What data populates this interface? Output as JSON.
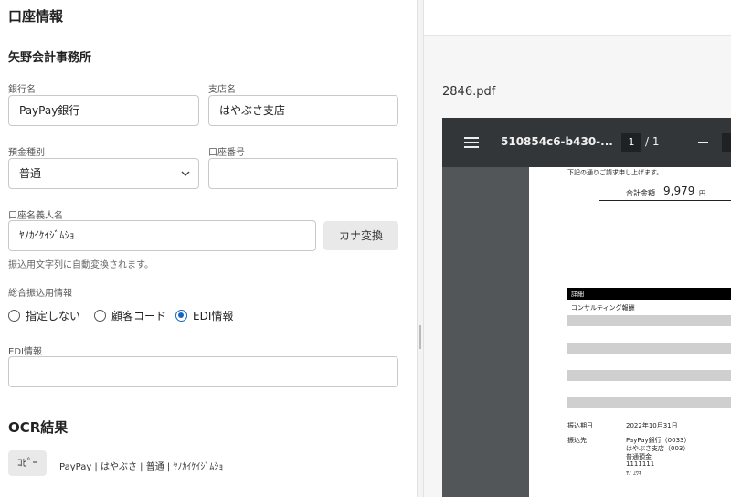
{
  "left": {
    "section_title": "口座情報",
    "company_name": "矢野会計事務所",
    "bank": {
      "label": "銀行名",
      "value": "PayPay銀行"
    },
    "branch": {
      "label": "支店名",
      "value": "はやぶさ支店"
    },
    "account_type": {
      "label": "預金種別",
      "value": "普通",
      "icon": "chevron-down-icon"
    },
    "account_number": {
      "label": "口座番号",
      "value": ""
    },
    "holder": {
      "label": "口座名義人名",
      "value": "ﾔﾉｶｲｹｲｼﾞﾑｼｮ",
      "convert_button": "カナ変換",
      "hint": "振込用文字列に自動変換されます。"
    },
    "transfer_info": {
      "label": "総合振込用情報",
      "options": [
        {
          "label": "指定しない",
          "selected": false
        },
        {
          "label": "顧客コード",
          "selected": false
        },
        {
          "label": "EDI情報",
          "selected": true
        }
      ]
    },
    "edi": {
      "label": "EDI情報",
      "value": ""
    },
    "ocr": {
      "title": "OCR結果",
      "copy_button": "ｺﾋﾟｰ",
      "text": "PayPay | はやぶさ | 普通 | ﾔﾉｶｲｹｲｼﾞﾑｼｮ"
    }
  },
  "preview": {
    "file_name": "2846.pdf",
    "viewer": {
      "doc_title": "510854c6-b430-...",
      "page_current": "1",
      "page_total": "/ 1"
    },
    "page": {
      "intro": "下記の通りご請求申し上げます。",
      "total_label": "合計金額",
      "total_value": "9,979",
      "total_unit": "円",
      "detail_header": "詳細",
      "detail_item": "コンサルティング報酬",
      "due_label": "振込期日",
      "due_value": "2022年10月31日",
      "dest_label": "振込先",
      "dest_lines": [
        "PayPay銀行（0033）",
        "はやぶさ支店（003）",
        "普通預金",
        "1111111",
        "ﾔﾉ ﾕｳｷ"
      ]
    }
  },
  "colors": {
    "accent": "#1565c0",
    "viewer_bg": "#525659",
    "viewer_toolbar": "#323639"
  }
}
